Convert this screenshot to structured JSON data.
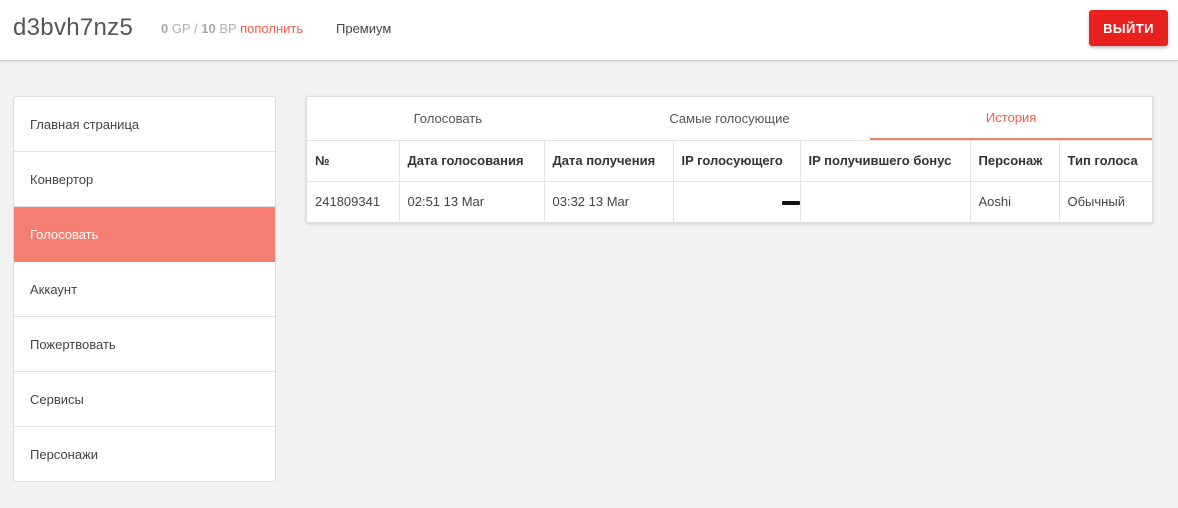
{
  "header": {
    "username": "d3bvh7nz5",
    "gp_value": "0",
    "gp_unit": "GP",
    "separator": "/",
    "bp_value": "10",
    "bp_unit": "BP",
    "topup_label": "пополнить",
    "premium_label": "Премиум",
    "logout_label": "ВЫЙТИ"
  },
  "sidebar": {
    "items": [
      {
        "label": "Главная страница"
      },
      {
        "label": "Конвертор"
      },
      {
        "label": "Голосовать",
        "active": true
      },
      {
        "label": "Аккаунт"
      },
      {
        "label": "Пожертвовать"
      },
      {
        "label": "Сервисы"
      },
      {
        "label": "Персонажи"
      }
    ]
  },
  "tabs": [
    {
      "label": "Голосовать"
    },
    {
      "label": "Самые голосующие"
    },
    {
      "label": "История",
      "active": true
    }
  ],
  "table": {
    "columns": [
      "№",
      "Дата голосования",
      "Дата получения",
      "IP голосующего",
      "IP получившего бонус",
      "Персонаж",
      "Тип голоса"
    ],
    "rows": [
      [
        "241809341",
        "02:51 13 Mar",
        "03:32 13 Mar",
        "",
        "",
        "Aoshi",
        "Обычный"
      ]
    ]
  },
  "colors": {
    "accent": "#f67e70",
    "logout": "#e8211f",
    "topup_link": "#f0604a"
  }
}
